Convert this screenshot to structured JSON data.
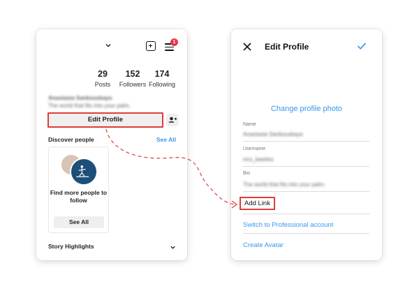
{
  "colors": {
    "accent": "#3897f0",
    "highlight": "#e03c3c",
    "badge": "#e8364a"
  },
  "left": {
    "header": {
      "notification_count": "1"
    },
    "stats": [
      {
        "value": "29",
        "label": "Posts"
      },
      {
        "value": "152",
        "label": "Followers"
      },
      {
        "value": "174",
        "label": "Following"
      }
    ],
    "profile": {
      "name": "Anastasia Sankouskaya",
      "bio": "The world that fits into your palm."
    },
    "edit_profile_label": "Edit Profile",
    "discover": {
      "title": "Discover people",
      "see_all_link": "See All",
      "card_text": "Find more people to follow",
      "card_button": "See All"
    },
    "story_highlights": "Story Highlights"
  },
  "right": {
    "title": "Edit Profile",
    "change_photo": "Change profile photo",
    "fields": [
      {
        "label": "Name",
        "value": "Anastasia Sankouskaya"
      },
      {
        "label": "Username",
        "value": "mrs_beeties"
      },
      {
        "label": "Bio",
        "value": "The world that fits into your palm."
      }
    ],
    "add_link": "Add Link",
    "switch_account": "Switch to Professional account",
    "create_avatar": "Create Avatar"
  },
  "icons": {
    "left_header": [
      "chevron-down-icon",
      "new-post-icon",
      "menu-icon"
    ],
    "right_header": [
      "close-icon",
      "check-icon"
    ],
    "discover": "add-person-icon",
    "connector": "dashed-arrow-icon"
  }
}
